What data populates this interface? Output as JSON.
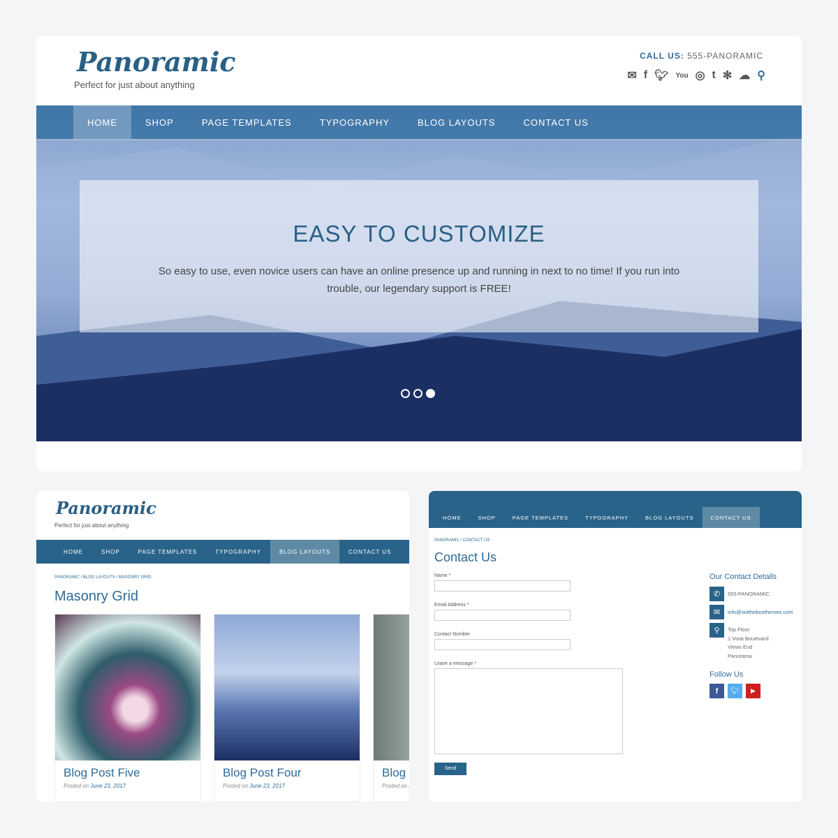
{
  "main": {
    "logo": "Panoramic",
    "tagline": "Perfect for just about anything",
    "call_label": "CALL US:",
    "call_number": "555-PANORAMIC",
    "social_icons": [
      "envelope-icon",
      "facebook-icon",
      "twitter-icon",
      "youtube-icon",
      "instagram-icon",
      "tumblr-icon",
      "yelp-icon",
      "soundcloud-icon",
      "search-icon"
    ],
    "nav": [
      "HOME",
      "SHOP",
      "PAGE TEMPLATES",
      "TYPOGRAPHY",
      "BLOG LAYOUTS",
      "CONTACT US"
    ],
    "active_nav": 0,
    "hero": {
      "title": "EASY TO CUSTOMIZE",
      "text": "So easy to use, even novice users can have an online presence up and running in next to no time! If you run into trouble, our legendary support is FREE!",
      "slides": 3,
      "active_slide": 3
    }
  },
  "blog": {
    "logo": "Panoramic",
    "tagline": "Perfect for just about anything",
    "nav": [
      "HOME",
      "SHOP",
      "PAGE TEMPLATES",
      "TYPOGRAPHY",
      "BLOG LAYOUTS",
      "CONTACT US"
    ],
    "active_nav": 4,
    "breadcrumb": "PANORAMIC / BLOG LAYOUTS / MASONRY GRID",
    "title": "Masonry Grid",
    "posts": [
      {
        "title": "Blog Post Five",
        "posted": "Posted on",
        "date": "June 23, 2017"
      },
      {
        "title": "Blog Post Four",
        "posted": "Posted on",
        "date": "June 23, 2017"
      },
      {
        "title": "Blog",
        "posted": "Posted on",
        "date": "J"
      }
    ]
  },
  "contact": {
    "nav": [
      "HOME",
      "SHOP",
      "PAGE TEMPLATES",
      "TYPOGRAPHY",
      "BLOG LAYOUTS",
      "CONTACT US"
    ],
    "active_nav": 5,
    "breadcrumb": "PANORAMIC / CONTACT US",
    "title": "Contact Us",
    "fields": {
      "name": "Name *",
      "email": "Email Address *",
      "number": "Contact Number",
      "message": "Leave a message *"
    },
    "send": "Send",
    "details_title": "Our Contact Details",
    "phone": "555-PANORAMIC",
    "email": "info@outtheboxthemes.com",
    "address": [
      "Top Floor",
      "1 Vista Boulevard",
      "Views End",
      "Panorama"
    ],
    "follow_title": "Follow Us",
    "colors": {
      "facebook": "#3b5998",
      "twitter": "#55acee",
      "youtube": "#cd201f"
    }
  }
}
